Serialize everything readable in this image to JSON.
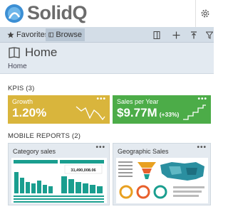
{
  "brand": {
    "name": "SolidQ"
  },
  "toolbar": {
    "favorites_label": "Favorites",
    "browse_label": "Browse"
  },
  "home": {
    "title": "Home",
    "breadcrumb": "Home"
  },
  "kpis": {
    "section_label": "KPIS (3)",
    "items": [
      {
        "title": "Growth",
        "value": "1.20%",
        "delta": "",
        "color": "#d9b53c"
      },
      {
        "title": "Sales per Year",
        "value": "$9.77M",
        "delta": "(+33%)",
        "color": "#4cac48"
      }
    ]
  },
  "mobile_reports": {
    "section_label": "MOBILE REPORTS (2)",
    "items": [
      {
        "title": "Category sales",
        "thumb_value": "31,490,008.06"
      },
      {
        "title": "Geographic Sales"
      }
    ]
  },
  "more_label": "•••",
  "colors": {
    "toolbar": "#d3dde7",
    "header": "#e3eaf1",
    "teal": "#1a9e8f",
    "map": "#2a8fa0"
  }
}
